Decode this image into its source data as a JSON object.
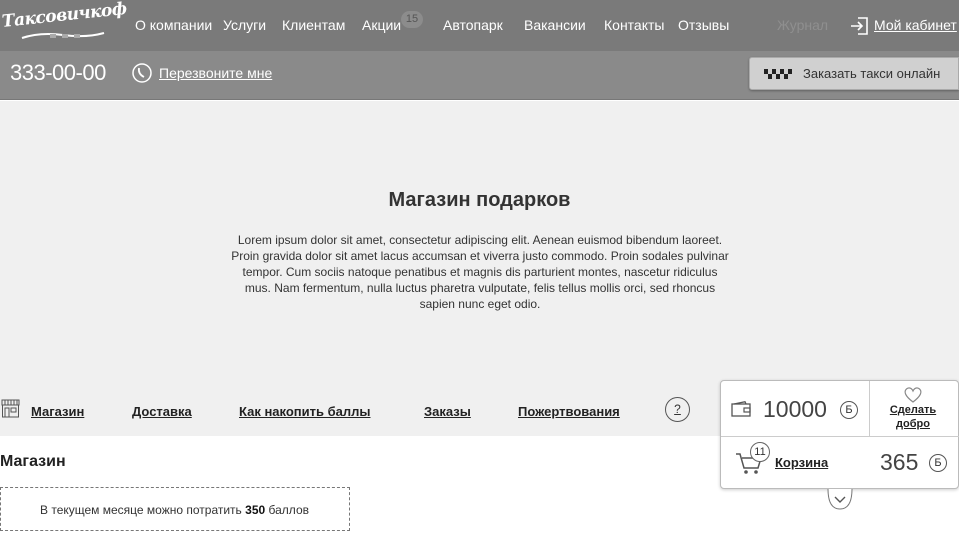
{
  "header": {
    "logo_text": "Таксовичкоф",
    "nav": [
      "О компании",
      "Услуги",
      "Клиентам",
      "Акции",
      "Автопарк",
      "Вакансии",
      "Контакты",
      "Отзывы"
    ],
    "promo_badge": "15",
    "journal": "Журнал",
    "cabinet": "Мой кабинет"
  },
  "subheader": {
    "phone": "333-00-00",
    "callback": "Перезвоните мне",
    "order_button": "Заказать такси онлайн"
  },
  "hero": {
    "title": "Магазин подарков",
    "text": "Lorem ipsum dolor sit amet, consectetur adipiscing elit. Aenean euismod bibendum laoreet. Proin gravida dolor sit amet lacus accumsan et viverra justo commodo. Proin sodales pulvinar tempor. Cum sociis natoque penatibus et magnis dis parturient montes, nascetur ridiculus mus. Nam fermentum, nulla luctus pharetra vulputate, felis tellus mollis orci, sed rhoncus sapien nunc eget odio."
  },
  "shop_nav": {
    "items": [
      "Магазин",
      "Доставка",
      "Как накопить баллы",
      "Заказы",
      "Пожертвования"
    ],
    "help": "?"
  },
  "balance": {
    "points": "10000",
    "points_unit": "Б",
    "donate": "Сделать добро",
    "cart_count": "11",
    "cart_label": "Корзина",
    "cart_sum": "365",
    "cart_unit": "Б"
  },
  "shop": {
    "title": "Магазин",
    "limit_prefix": "В текущем месяце можно потратить",
    "limit_value": "350",
    "limit_suffix": "баллов"
  }
}
